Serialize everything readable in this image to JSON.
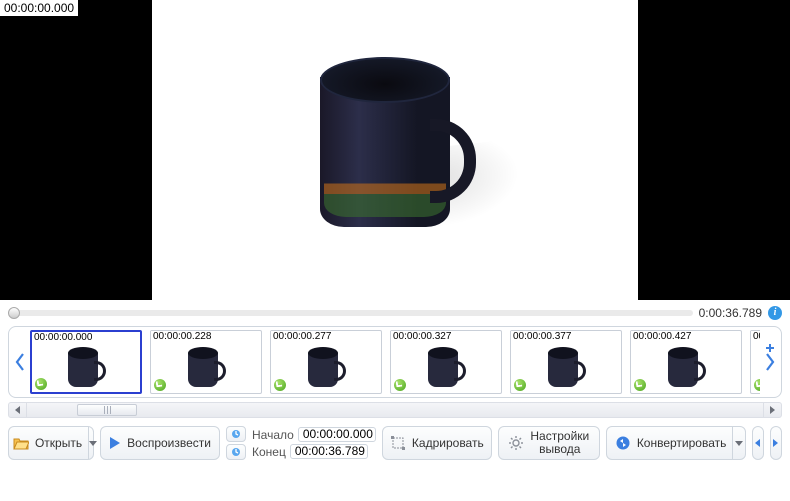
{
  "preview": {
    "timestamp": "00:00:00.000"
  },
  "progress": {
    "total_time": "0:00:36.789"
  },
  "thumbnails": [
    {
      "time": "00:00:00.000",
      "selected": true
    },
    {
      "time": "00:00:00.228",
      "selected": false
    },
    {
      "time": "00:00:00.277",
      "selected": false
    },
    {
      "time": "00:00:00.327",
      "selected": false
    },
    {
      "time": "00:00:00.377",
      "selected": false
    },
    {
      "time": "00:00:00.427",
      "selected": false
    }
  ],
  "thumbnail_partial_label": "00:0",
  "markers": {
    "start_label": "Начало",
    "start_value": "00:00:00.000",
    "end_label": "Конец",
    "end_value": "00:00:36.789"
  },
  "toolbar": {
    "open": "Открыть",
    "play": "Воспроизвести",
    "crop": "Кадрировать",
    "output_settings_line1": "Настройки",
    "output_settings_line2": "вывода",
    "convert": "Конвертировать"
  }
}
